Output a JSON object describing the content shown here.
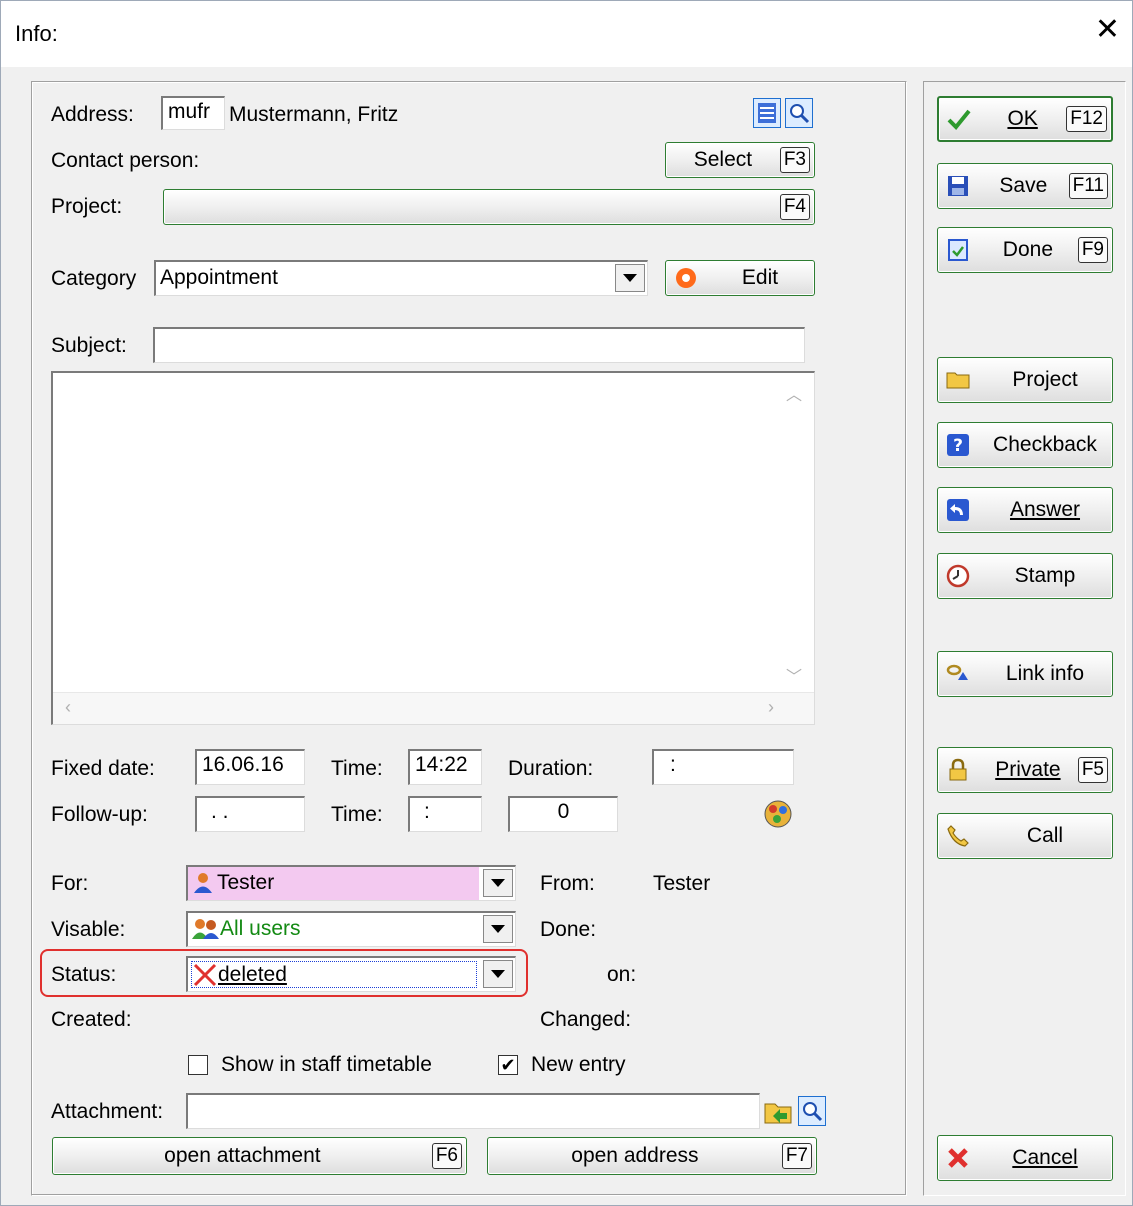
{
  "window": {
    "title": "Info:",
    "close_glyph": "✕"
  },
  "address": {
    "label": "Address:",
    "code": "mufr",
    "name": "Mustermann, Fritz"
  },
  "contact": {
    "label": "Contact person:",
    "select_label": "Select",
    "select_key": "F3"
  },
  "project": {
    "label": "Project:",
    "key": "F4"
  },
  "category": {
    "label": "Category",
    "value": "Appointment",
    "edit_label": "Edit"
  },
  "subject": {
    "label": "Subject:",
    "value": ""
  },
  "dates": {
    "fixed_label": "Fixed date:",
    "fixed_value": "16.06.16",
    "time_label": "Time:",
    "time_value": "14:22",
    "duration_label": "Duration:",
    "duration_value": ":",
    "followup_label": "Follow-up:",
    "followup_value": ". .",
    "followup_time_label": "Time:",
    "followup_time_value": ":",
    "followup_count": "0"
  },
  "for": {
    "label": "For:",
    "value": "Tester",
    "from_label": "From:",
    "from_value": "Tester"
  },
  "visible": {
    "label": "Visable:",
    "value": "All users",
    "done_label": "Done:"
  },
  "status": {
    "label": "Status:",
    "value": "deleted",
    "on_label": "on:"
  },
  "meta": {
    "created_label": "Created:",
    "changed_label": "Changed:"
  },
  "options": {
    "staff_label": "Show in staff timetable",
    "staff_checked": false,
    "new_label": "New entry",
    "new_checked": true
  },
  "attachment": {
    "label": "Attachment:",
    "value": ""
  },
  "bottom": {
    "open_attachment": "open attachment",
    "open_attachment_key": "F6",
    "open_address": "open address",
    "open_address_key": "F7"
  },
  "side": {
    "ok": "OK",
    "ok_key": "F12",
    "save": "Save",
    "save_key": "F11",
    "done": "Done",
    "done_key": "F9",
    "project": "Project",
    "checkback": "Checkback",
    "answer": "Answer",
    "stamp": "Stamp",
    "link_info": "Link info",
    "private": "Private",
    "private_key": "F5",
    "call": "Call",
    "cancel": "Cancel"
  },
  "colors": {
    "accent_green": "#2e7d32",
    "highlight": "#e0302e",
    "for_bg": "#f3c9f0",
    "status_bg": "#1c3fd6",
    "visible_text": "#138a13"
  }
}
